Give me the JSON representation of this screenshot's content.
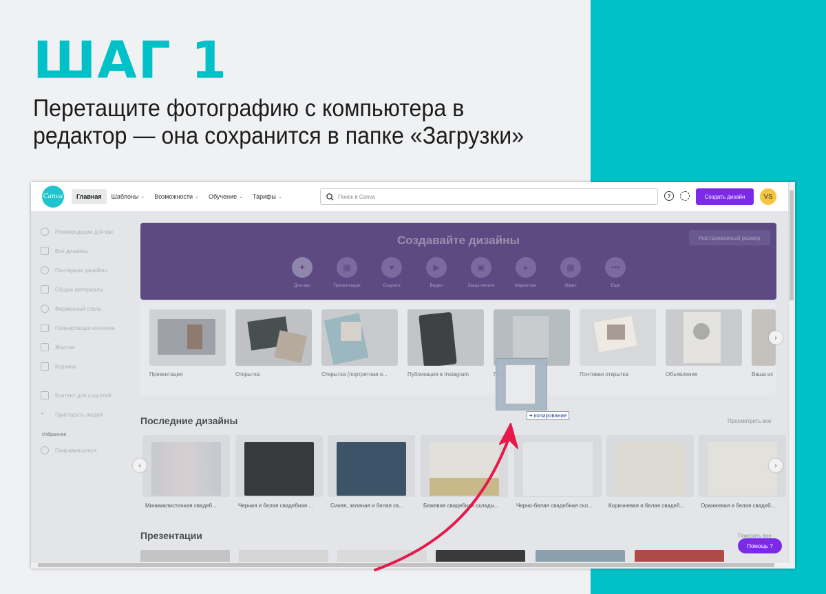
{
  "instruction": {
    "step": "ШАГ 1",
    "text": "Перетащите фотографию с компьютера в редактор — она сохранится в папке «Загрузки»"
  },
  "colors": {
    "accent_teal": "#00c0c8",
    "canva_purple": "#7d2ae8",
    "arrow_red": "#e5194a"
  },
  "topbar": {
    "logo": "Canva",
    "nav": [
      {
        "label": "Главная",
        "active": true,
        "dropdown": false
      },
      {
        "label": "Шаблоны",
        "dropdown": true
      },
      {
        "label": "Возможности",
        "dropdown": true
      },
      {
        "label": "Обучение",
        "dropdown": true
      },
      {
        "label": "Тарифы",
        "dropdown": true
      }
    ],
    "search_placeholder": "Поиск в Canva",
    "help_icon": "help-circle-icon",
    "settings_icon": "gear-icon",
    "create_button": "Создать дизайн",
    "avatar": "VS"
  },
  "sidebar": {
    "items": [
      "Рекомендации для вас",
      "Все дизайны",
      "Последние дизайны",
      "Общие материалы",
      "Фирменный стиль",
      "Планировщик контента",
      "Желтая",
      "Корзина"
    ],
    "items2": [
      "Контент для соцсетей",
      "Пригласить людей"
    ],
    "section": "Избранное",
    "favorites": [
      "Понравившееся"
    ]
  },
  "hero": {
    "title": "Создавайте дизайны",
    "custom_size": "Настраиваемый размер",
    "categories": [
      {
        "label": "Для вас",
        "icon": "sparkle-icon"
      },
      {
        "label": "Презентации",
        "icon": "presentation-icon"
      },
      {
        "label": "Соцсети",
        "icon": "heart-chat-icon"
      },
      {
        "label": "Видео",
        "icon": "video-icon"
      },
      {
        "label": "Заказ печати",
        "icon": "print-icon"
      },
      {
        "label": "Маркетинг",
        "icon": "megaphone-icon"
      },
      {
        "label": "Офис",
        "icon": "briefcase-icon"
      },
      {
        "label": "Еще",
        "icon": "more-icon"
      }
    ]
  },
  "templates": [
    "Презентация",
    "Открытка",
    "Открытка (портретная о...",
    "Публикация в Instagram",
    "Пр...",
    "Почтовая открытка",
    "Объявление",
    "Ваша ис"
  ],
  "recent": {
    "title": "Последние дизайны",
    "link": "Просмотреть все",
    "items": [
      "Минималистичная свадеб...",
      "Черная и белая свадебная ...",
      "Синяя, зеленая и белая св...",
      "Бежевая свадебная склады...",
      "Черно-белая свадебная скл...",
      "Коричневая и белая свадеб...",
      "Оранжевая и белая свадеб..."
    ]
  },
  "presentations": {
    "title": "Презентации",
    "link": "Показать все"
  },
  "help_button": "Помощь ?",
  "drag": {
    "copy_label": "копирование"
  }
}
